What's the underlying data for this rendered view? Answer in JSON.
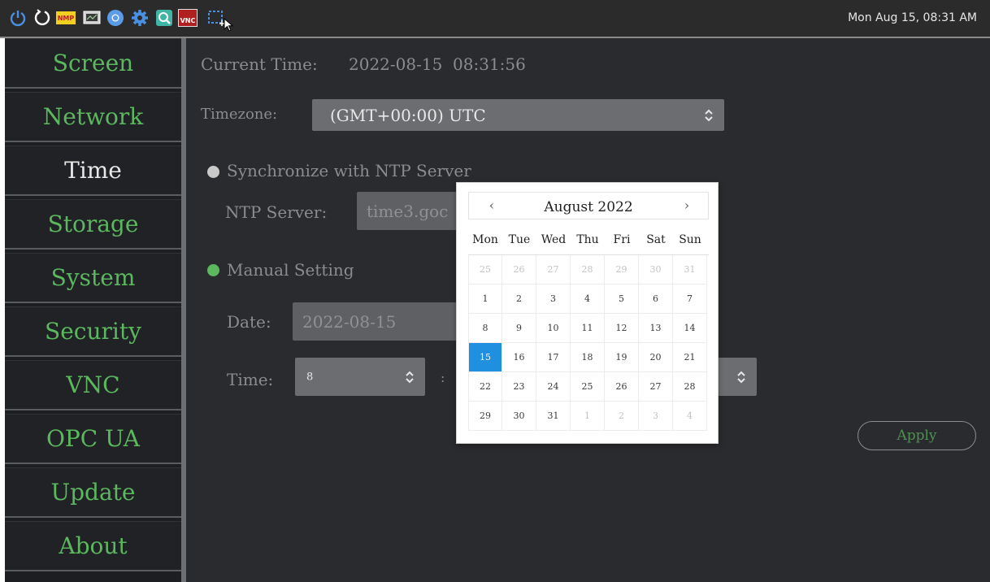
{
  "taskbar": {
    "icons": [
      "power-icon",
      "restart-icon",
      "nmp-icon",
      "monitor-icon",
      "chromium-icon",
      "settings-icon",
      "search-app-icon",
      "tightvnc-icon",
      "screenshot-icon"
    ],
    "nmp_text": "NMP",
    "vnc_text": "VNC",
    "clock": "Mon Aug 15, 08:31 AM"
  },
  "sidebar": {
    "items": [
      {
        "label": "Screen"
      },
      {
        "label": "Network"
      },
      {
        "label": "Time"
      },
      {
        "label": "Storage"
      },
      {
        "label": "System"
      },
      {
        "label": "Security"
      },
      {
        "label": "VNC"
      },
      {
        "label": "OPC UA"
      },
      {
        "label": "Update"
      },
      {
        "label": "About"
      }
    ],
    "active_index": 2
  },
  "time": {
    "current_label": "Current Time:",
    "current_value": "2022-08-15  08:31:56",
    "timezone_label": "Timezone:",
    "timezone_value": "(GMT+00:00) UTC",
    "ntp_option": "Synchronize with NTP Server",
    "ntp_server_label": "NTP Server:",
    "ntp_server_value": "time3.goc",
    "manual_option": "Manual Setting",
    "date_label": "Date:",
    "date_value": "2022-08-15",
    "time_label": "Time:",
    "hour_value": "8",
    "separator": ":",
    "apply_label": "Apply"
  },
  "calendar": {
    "title": "August 2022",
    "prev": "‹",
    "next": "›",
    "weekdays": [
      "Mon",
      "Tue",
      "Wed",
      "Thu",
      "Fri",
      "Sat",
      "Sun"
    ],
    "weeks": [
      [
        "25",
        "26",
        "27",
        "28",
        "29",
        "30",
        "31"
      ],
      [
        "1",
        "2",
        "3",
        "4",
        "5",
        "6",
        "7"
      ],
      [
        "8",
        "9",
        "10",
        "11",
        "12",
        "13",
        "14"
      ],
      [
        "15",
        "16",
        "17",
        "18",
        "19",
        "20",
        "21"
      ],
      [
        "22",
        "23",
        "24",
        "25",
        "26",
        "27",
        "28"
      ],
      [
        "29",
        "30",
        "31",
        "1",
        "2",
        "3",
        "4"
      ]
    ],
    "selected": "15"
  },
  "colors": {
    "accent_green": "#5bb85e",
    "selected_blue": "#1f8fe0",
    "main_bg": "#2a2b2e"
  }
}
